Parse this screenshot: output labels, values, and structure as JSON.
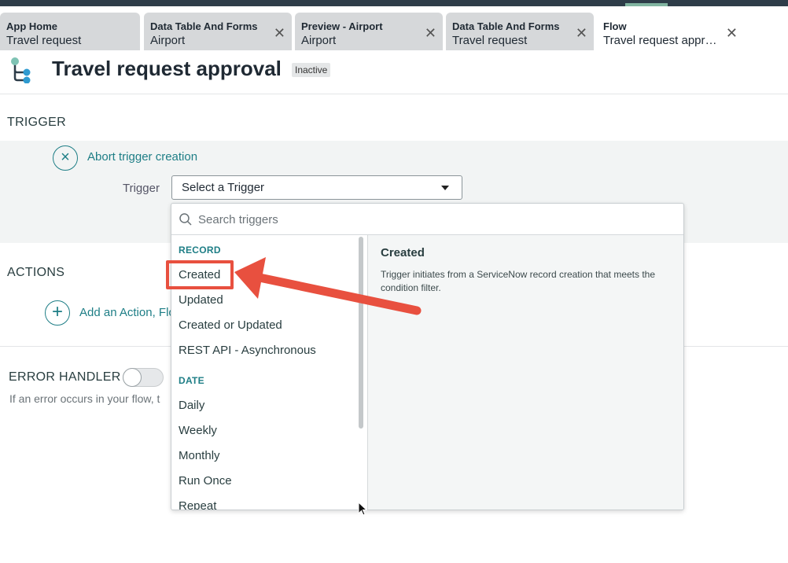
{
  "tabs": [
    {
      "title": "App Home",
      "subtitle": "Travel request",
      "closable": false
    },
    {
      "title": "Data Table And Forms",
      "subtitle": "Airport",
      "closable": true
    },
    {
      "title": "Preview - Airport",
      "subtitle": "Airport",
      "closable": true
    },
    {
      "title": "Data Table And Forms",
      "subtitle": "Travel request",
      "closable": true
    },
    {
      "title": "Flow",
      "subtitle": "Travel request appro...",
      "closable": true,
      "active": true
    }
  ],
  "header": {
    "title": "Travel request approval",
    "status": "Inactive"
  },
  "trigger": {
    "section_label": "TRIGGER",
    "abort_label": "Abort trigger creation",
    "field_label": "Trigger",
    "select_value": "Select a Trigger"
  },
  "actions": {
    "section_label": "ACTIONS",
    "add_label": "Add an Action, Flo"
  },
  "error_handler": {
    "section_label": "ERROR HANDLER",
    "note": "If an error occurs in your flow, t",
    "enabled": false
  },
  "dropdown": {
    "search_placeholder": "Search triggers",
    "groups": [
      {
        "label": "RECORD",
        "items": [
          "Created",
          "Updated",
          "Created or Updated",
          "REST API - Asynchronous"
        ]
      },
      {
        "label": "DATE",
        "items": [
          "Daily",
          "Weekly",
          "Monthly",
          "Run Once",
          "Repeat"
        ]
      }
    ],
    "detail": {
      "title": "Created",
      "description": "Trigger initiates from a ServiceNow record creation that meets the condition filter."
    }
  },
  "colors": {
    "accent": "#1e7e86",
    "annotation": "#e8503f",
    "topbar": "#2e3d49"
  }
}
